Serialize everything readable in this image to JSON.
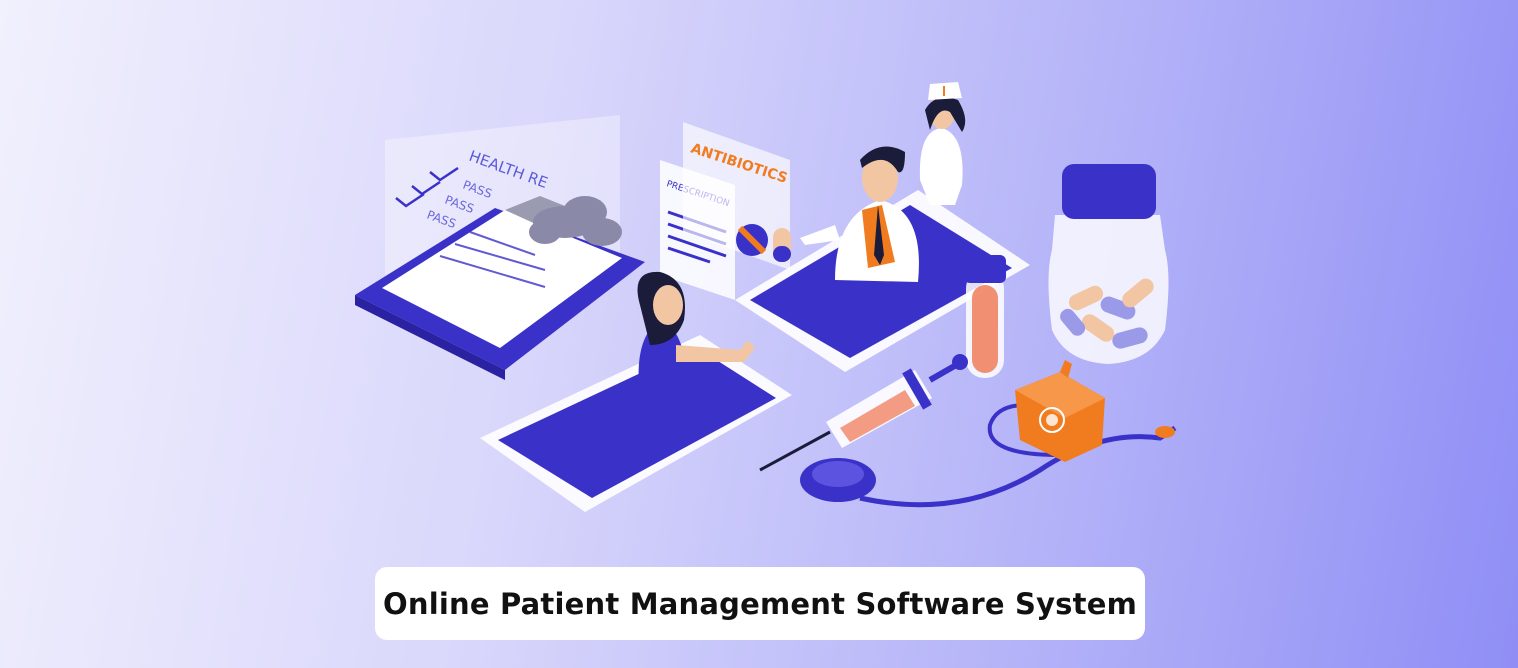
{
  "banner": {
    "title": "Online Patient Management Software System",
    "background_colors": [
      "#f1f0fd",
      "#d9d7fb",
      "#b3b2f8",
      "#8f8ef5"
    ]
  },
  "illustration": {
    "clipboard_heading": "HEALTH RE",
    "checklist": [
      "PASS",
      "PASS",
      "PASS"
    ],
    "prescription_label": "PRESCRIPTION",
    "antibiotics_label": "ANTIBIOTICS",
    "icons": [
      "clipboard",
      "cloud",
      "tablet",
      "doctor",
      "nurse",
      "patient",
      "test-tube",
      "pill-bottle",
      "syringe",
      "stethoscope",
      "wallet"
    ],
    "colors": {
      "primary_blue": "#3a31c9",
      "accent_orange": "#f07c1f",
      "pill_peach": "#f3c6a3"
    }
  }
}
